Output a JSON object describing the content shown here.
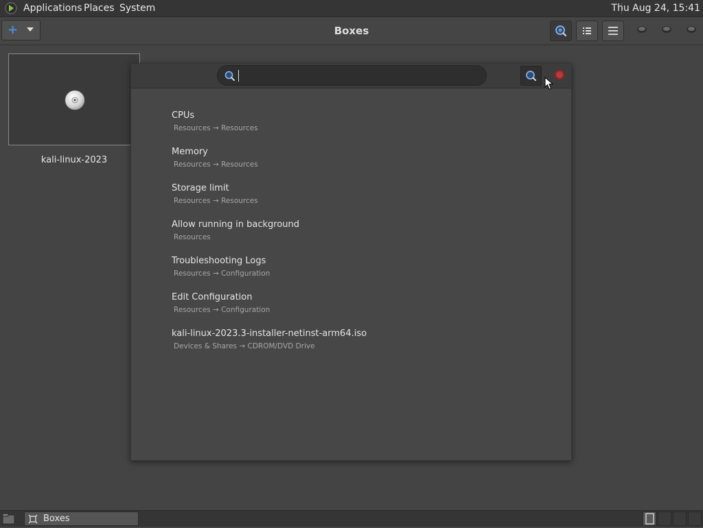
{
  "top_panel": {
    "menus": [
      "Applications",
      "Places",
      "System"
    ],
    "clock": "Thu Aug 24, 15:41"
  },
  "headerbar": {
    "title": "Boxes"
  },
  "box": {
    "name": "kali-linux-2023"
  },
  "search": {
    "value": "",
    "results": [
      {
        "title": "CPUs",
        "path": "Resources → Resources"
      },
      {
        "title": "Memory",
        "path": "Resources → Resources"
      },
      {
        "title": "Storage limit",
        "path": "Resources → Resources"
      },
      {
        "title": "Allow running in background",
        "path": "Resources"
      },
      {
        "title": "Troubleshooting Logs",
        "path": "Resources → Configuration"
      },
      {
        "title": "Edit Configuration",
        "path": "Resources → Configuration"
      },
      {
        "title": "kali-linux-2023.3-installer-netinst-arm64.iso",
        "path": "Devices & Shares → CDROM/DVD Drive"
      }
    ]
  },
  "taskbar": {
    "task_label": "Boxes"
  },
  "colors": {
    "accent": "#4a90d9",
    "close": "#b83a3a",
    "background": "#444444"
  }
}
